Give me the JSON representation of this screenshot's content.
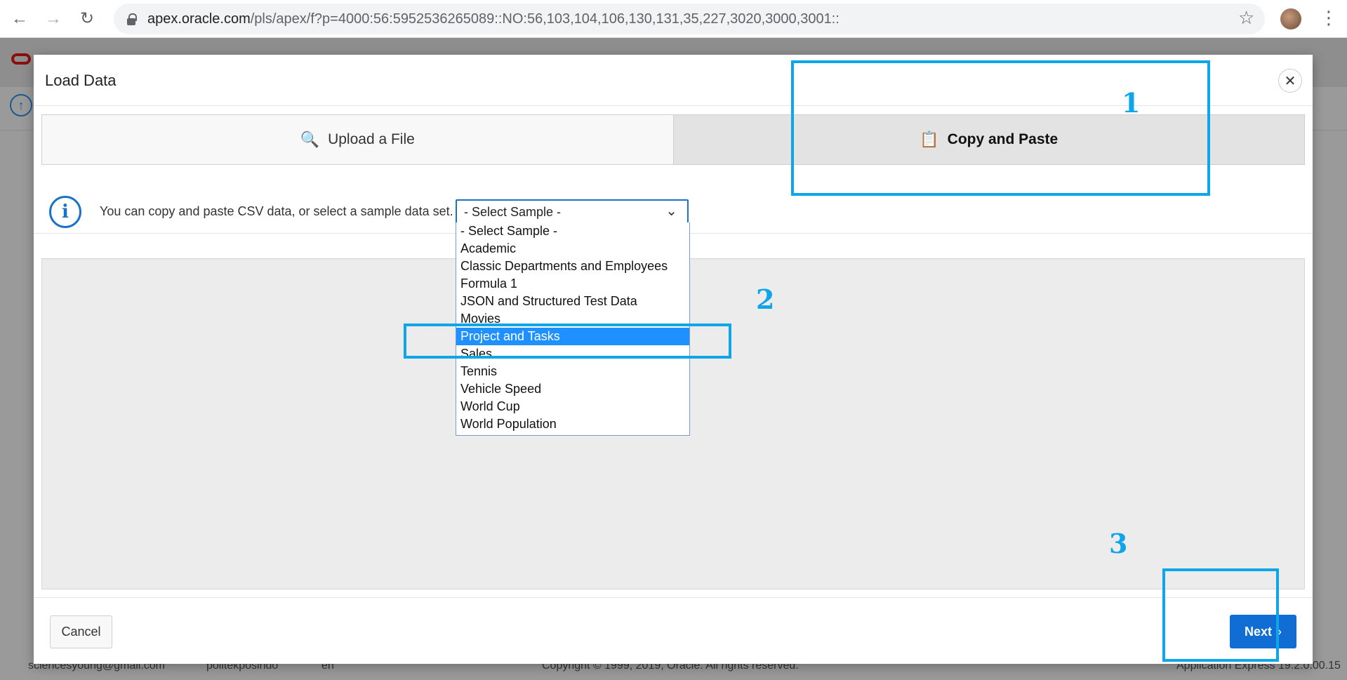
{
  "browser": {
    "url_host": "apex.oracle.com",
    "url_path": "/pls/apex/f?p=4000:56:5952536265089::NO:56,103,104,106,130,131,35,227,3020,3000,3001::"
  },
  "footer": {
    "user": "sciencesyoung@gmail.com",
    "workspace": "politekposindo",
    "language": "en",
    "copyright": "Copyright © 1999, 2019, Oracle. All rights reserved.",
    "version": "Application Express 19.2.0.00.15"
  },
  "dialog": {
    "title": "Load Data",
    "tabs": [
      {
        "label": "Upload a File",
        "icon": "file-search-icon"
      },
      {
        "label": "Copy and Paste",
        "icon": "clipboard-icon"
      }
    ],
    "info_text": "You can copy and paste CSV data, or select a sample data set.",
    "select": {
      "value": "- Select Sample -",
      "options": [
        "- Select Sample -",
        "Academic",
        "Classic Departments and Employees",
        "Formula 1",
        "JSON and Structured Test Data",
        "Movies",
        "Project and Tasks",
        "Sales",
        "Tennis",
        "Vehicle Speed",
        "World Cup",
        "World Population"
      ],
      "highlighted": "Project and Tasks"
    },
    "cancel_label": "Cancel",
    "next_label": "Next"
  },
  "annotations": {
    "one": "1",
    "two": "2",
    "three": "3",
    "color": "#0ea5e9"
  }
}
